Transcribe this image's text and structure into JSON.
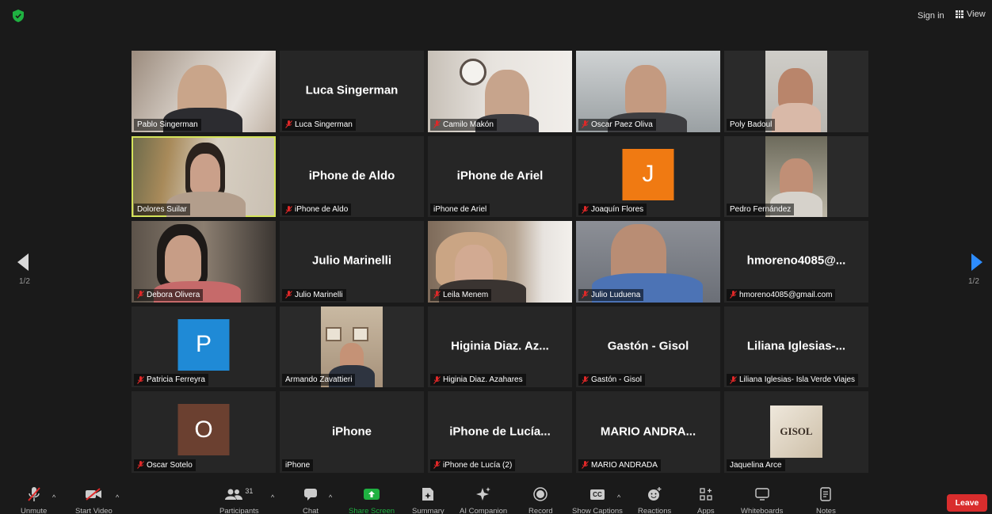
{
  "top": {
    "sign_in": "Sign in",
    "view": "View"
  },
  "tiles": [
    {
      "label": "Pablo Singerman",
      "big": "",
      "muted": false
    },
    {
      "label": "Luca Singerman",
      "big": "Luca Singerman",
      "muted": true
    },
    {
      "label": "Camilo Makón",
      "big": "",
      "muted": true
    },
    {
      "label": "Oscar Paez Oliva",
      "big": "",
      "muted": true
    },
    {
      "label": "Poly Badoul",
      "big": "",
      "muted": false
    },
    {
      "label": "Dolores Suilar",
      "big": "",
      "muted": false
    },
    {
      "label": "iPhone de Aldo",
      "big": "iPhone de Aldo",
      "muted": true
    },
    {
      "label": "iPhone de Ariel",
      "big": "iPhone de Ariel",
      "muted": false
    },
    {
      "label": "Joaquín Flores",
      "big": "",
      "avatar": "J",
      "avatar_color": "#f07a12",
      "muted": true
    },
    {
      "label": "Pedro Fernández",
      "big": "",
      "muted": false
    },
    {
      "label": "Debora Olivera",
      "big": "",
      "muted": true
    },
    {
      "label": "Julio Marinelli",
      "big": "Julio Marinelli",
      "muted": true
    },
    {
      "label": "Leila Menem",
      "big": "",
      "muted": true
    },
    {
      "label": "Julio Luduena",
      "big": "",
      "muted": true
    },
    {
      "label": "hmoreno4085@gmail.com",
      "big": "hmoreno4085@...",
      "muted": true
    },
    {
      "label": "Patricia Ferreyra",
      "big": "",
      "avatar": "P",
      "avatar_color": "#1f8ad6",
      "muted": true
    },
    {
      "label": "Armando Zavattieri",
      "big": "",
      "muted": false
    },
    {
      "label": "Higinia Diaz. Azahares",
      "big": "Higinia  Diaz. Az...",
      "muted": true
    },
    {
      "label": "Gastón - Gisol",
      "big": "Gastón - Gisol",
      "muted": true
    },
    {
      "label": "Liliana Iglesias- Isla Verde Viajes",
      "big": "Liliana  Iglesias-...",
      "muted": true
    },
    {
      "label": "Oscar Sotelo",
      "big": "",
      "avatar": "O",
      "avatar_color": "#6b4030",
      "muted": true
    },
    {
      "label": "iPhone",
      "big": "iPhone",
      "muted": false
    },
    {
      "label": "iPhone de Lucía (2)",
      "big": "iPhone de Lucía...",
      "muted": true
    },
    {
      "label": "MARIO ANDRADA",
      "big": "MARIO  ANDRA...",
      "muted": true
    },
    {
      "label": "Jaquelina Arce",
      "big": "",
      "logo": "GISOL",
      "muted": false
    }
  ],
  "pagination": {
    "left": "1/2",
    "right": "1/2"
  },
  "toolbar": {
    "unmute": "Unmute",
    "start_video": "Start Video",
    "participants": "Participants",
    "participants_count": "31",
    "chat": "Chat",
    "share_screen": "Share Screen",
    "summary": "Summary",
    "ai_companion": "AI Companion",
    "record": "Record",
    "show_captions": "Show Captions",
    "cc": "CC",
    "reactions": "Reactions",
    "apps": "Apps",
    "whiteboards": "Whiteboards",
    "notes": "Notes",
    "leave": "Leave"
  },
  "colors": {
    "share_green": "#1fb141",
    "leave_red": "#d92d2d",
    "active_speaker": "#d4e35a",
    "nav_blue": "#2d8cff"
  }
}
